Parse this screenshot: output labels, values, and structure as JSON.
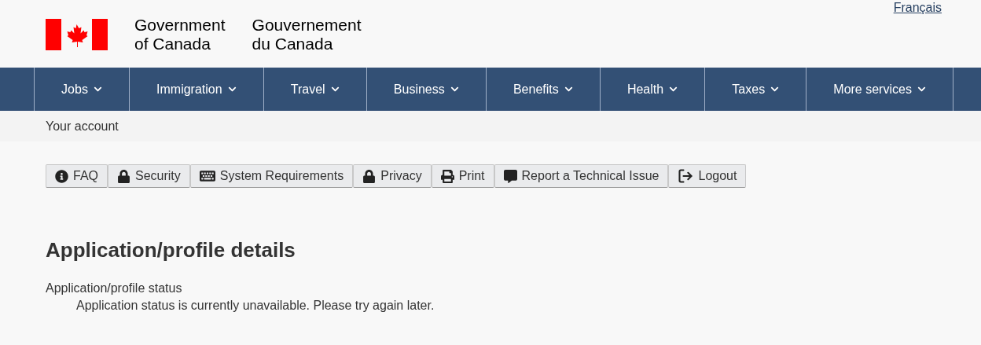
{
  "language_link": "Français",
  "signature": {
    "english": [
      "Government",
      "of Canada"
    ],
    "french": [
      "Gouvernement",
      "du Canada"
    ]
  },
  "menu": [
    {
      "label": "Jobs"
    },
    {
      "label": "Immigration"
    },
    {
      "label": "Travel"
    },
    {
      "label": "Business"
    },
    {
      "label": "Benefits"
    },
    {
      "label": "Health"
    },
    {
      "label": "Taxes"
    },
    {
      "label": "More services"
    }
  ],
  "breadcrumb": "Your account",
  "toolbar": [
    {
      "label": "FAQ",
      "kind": "info"
    },
    {
      "label": "Security",
      "kind": "lock"
    },
    {
      "label": "System Requirements",
      "kind": "keyboard"
    },
    {
      "label": "Privacy",
      "kind": "lock"
    },
    {
      "label": "Print",
      "kind": "print"
    },
    {
      "label": "Report a Technical Issue",
      "kind": "comment"
    },
    {
      "label": "Logout",
      "kind": "logout"
    }
  ],
  "heading": "Application/profile details",
  "status_label": "Application/profile status",
  "status_text": "Application status is currently unavailable. Please try again later."
}
